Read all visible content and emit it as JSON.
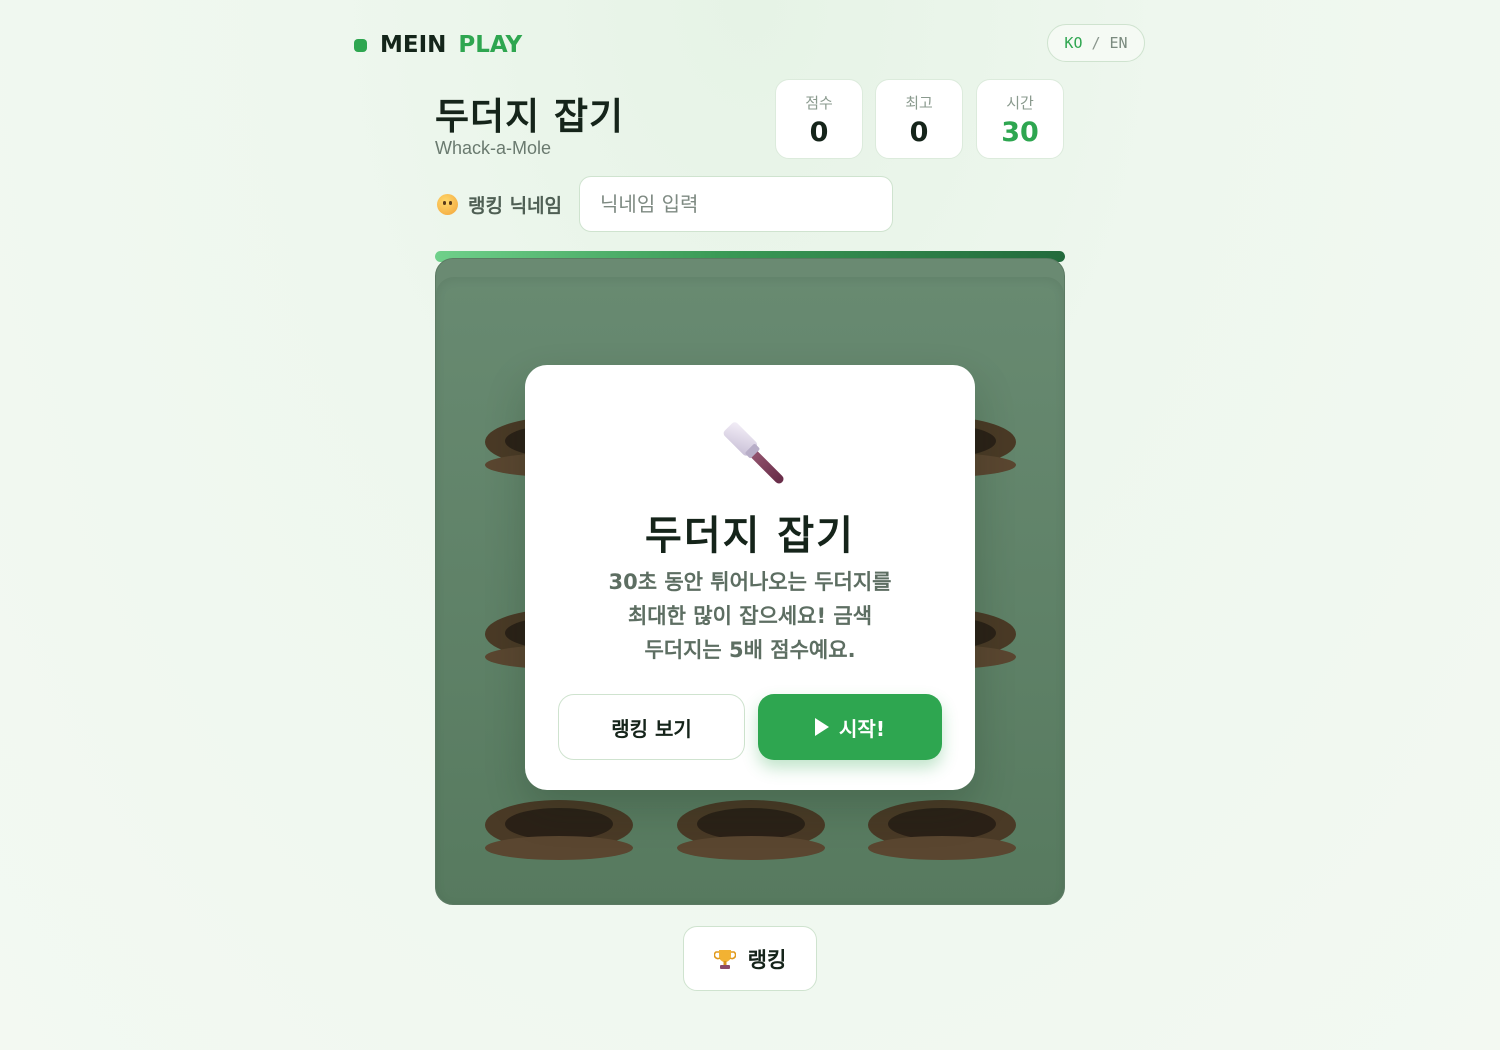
{
  "brand": {
    "name_left": "MEIN",
    "name_right": "PLAY",
    "accent_color": "#2ea650"
  },
  "lang": {
    "ko": "KO",
    "sep": "/",
    "en": "EN"
  },
  "game": {
    "title": "두더지 잡기",
    "subtitle": "Whack-a-Mole"
  },
  "stats": {
    "score": {
      "label": "점수",
      "value": "0"
    },
    "best": {
      "label": "최고",
      "value": "0"
    },
    "time": {
      "label": "시간",
      "value": "30"
    }
  },
  "nickname": {
    "emoji": "smiley-face-icon",
    "label": "랭킹 닉네임",
    "placeholder": "닉네임 입력",
    "value": ""
  },
  "timer_progress": 1.0,
  "board": {
    "rows": 3,
    "cols": 3
  },
  "modal": {
    "icon": "hammer-icon",
    "title": "두더지 잡기",
    "desc_line1": "30초 동안 튀어나오는 두더지를",
    "desc_line2": "최대한 많이 잡으세요! 금색",
    "desc_line3": "두더지는 5배 점수예요.",
    "rank_button": "랭킹 보기",
    "start_button": "시작!"
  },
  "footer": {
    "ranking_icon": "trophy-icon",
    "ranking_button": "랭킹"
  }
}
